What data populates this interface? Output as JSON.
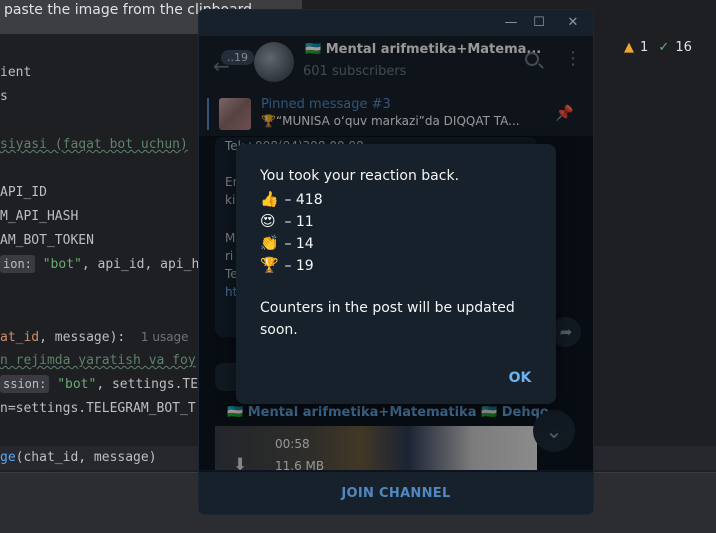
{
  "ide": {
    "paste_tip": "paste the image from the clipboard.",
    "inspections": {
      "warnings": "1",
      "weak_warnings": "16"
    },
    "lines": {
      "l1": "ient",
      "l2": "s",
      "l3": "siyasi (faqat bot uchun)",
      "l4": "API_ID",
      "l5": "M_API_HASH",
      "l6": "AM_BOT_TOKEN",
      "l7_hint": "ion:",
      "l7_str": "\"bot\"",
      "l7_rest": ", api_id, api_has",
      "l8_id": "at_id",
      "l8_rest": ", message):",
      "l8_usage": "1 usage",
      "l9": "n rejimda yaratish va foy",
      "l10_hint": "ssion:",
      "l10_str": "\"bot\"",
      "l10_rest": ", settings.TELE",
      "l11": "n=settings.TELEGRAM_BOT_T",
      "l12_fn": "ge",
      "l12_rest": "(chat_id, message)"
    }
  },
  "telegram": {
    "header": {
      "unread": "19",
      "title": "🇺🇿 Mental arifmetika+Matema...",
      "subscribers": "601 subscribers"
    },
    "pinned": {
      "title": "Pinned message #3",
      "text": "🏆“MUNISA o‘quv markazi”da  DIQQAT TA..."
    },
    "messages": {
      "phone": "Tel:+998(94)298 00 98",
      "frag_en": "En",
      "frag_ki": "ki",
      "frag_m": "M",
      "frag_ri": "ri",
      "frag_te": "Te",
      "frag_ht": "ht"
    },
    "post": {
      "author": "🇺🇿 Mental arifmetika+Matematika 🇺🇿 Dehqo...",
      "duration": "00:58",
      "size": "11.6 MB"
    },
    "join_label": "JOIN CHANNEL"
  },
  "dialog": {
    "line1": "You took your reaction back.",
    "reactions": [
      {
        "emoji": "👍",
        "count": "– 418"
      },
      {
        "emoji": "😍",
        "count": "– 11"
      },
      {
        "emoji": "👏",
        "count": "– 14"
      },
      {
        "emoji": "🏆",
        "count": "– 19"
      }
    ],
    "note_line1": "Counters in the post will be updated",
    "note_line2": "soon.",
    "ok_label": "OK"
  },
  "colors": {
    "accent": "#5288c1",
    "link": "#6ab3f3",
    "panel": "#17212b",
    "chat_bg": "#0e1621"
  }
}
